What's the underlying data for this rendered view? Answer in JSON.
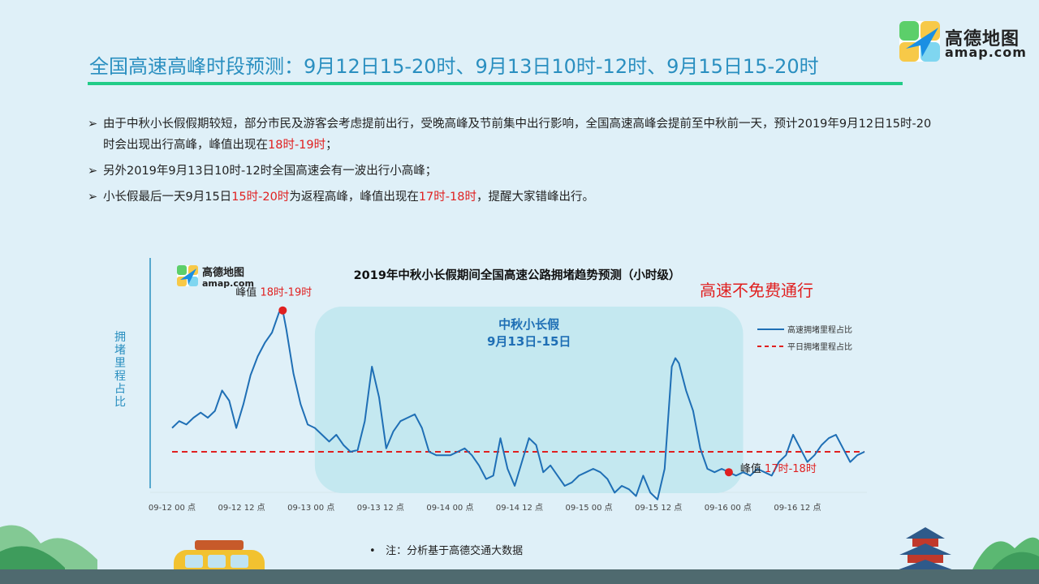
{
  "header": {
    "title": "全国高速高峰时段预测：9月12日15-20时、9月13日10时-12时、9月15日15-20时"
  },
  "logo": {
    "cn": "高德地图",
    "en": "amap.com"
  },
  "bullets": [
    {
      "parts": [
        {
          "text": "由于中秋小长假假期较短，部分市民及游客会考虑提前出行，受晚高峰及节前集中出行影响，全国高速高峰会提前至中秋前一天，预计2019年9月12日15时-20时会出现出行高峰，峰值出现在",
          "red": false
        },
        {
          "text": "18时-19时",
          "red": true
        },
        {
          "text": "；",
          "red": false
        }
      ]
    },
    {
      "parts": [
        {
          "text": "另外2019年9月13日10时-12时全国高速会有一波出行小高峰；",
          "red": false
        }
      ]
    },
    {
      "parts": [
        {
          "text": "小长假最后一天9月15日",
          "red": false
        },
        {
          "text": "15时-20时",
          "red": true
        },
        {
          "text": "为返程高峰，峰值出现在",
          "red": false
        },
        {
          "text": "17时-18时",
          "red": true
        },
        {
          "text": "，提醒大家错峰出行。",
          "red": false
        }
      ]
    }
  ],
  "chart_data": {
    "type": "line",
    "title": "2019年中秋小长假期间全国高速公路拥堵趋势预测（小时级）",
    "ylabel": "拥堵里程占比",
    "note_top_right": "高速不免费通行",
    "holiday": {
      "title": "中秋小长假",
      "dates": "9月13日-15日",
      "from_x": 20,
      "to_x": 80
    },
    "x_ticks": [
      "09-12 00 点",
      "09-12 12 点",
      "09-13 00 点",
      "09-13 12 点",
      "09-14 00 点",
      "09-14 12 点",
      "09-15 00 点",
      "09-15 12 点",
      "09-16 00 点",
      "09-16 12 点"
    ],
    "legend": [
      "高速拥堵里程占比",
      "平日拥堵里程占比"
    ],
    "baseline": 0,
    "annotations": [
      {
        "label": "峰值",
        "range": "18时-19时",
        "x": 15.5
      },
      {
        "label": "峰值",
        "range": "17时-18时",
        "x": 78
      }
    ],
    "series": [
      {
        "name": "高速拥堵里程占比",
        "points": [
          [
            0,
            14
          ],
          [
            1,
            18
          ],
          [
            2,
            16
          ],
          [
            3,
            20
          ],
          [
            4,
            23
          ],
          [
            5,
            20
          ],
          [
            6,
            24
          ],
          [
            7,
            36
          ],
          [
            8,
            30
          ],
          [
            9,
            14
          ],
          [
            10,
            28
          ],
          [
            11,
            45
          ],
          [
            12,
            56
          ],
          [
            13,
            64
          ],
          [
            14,
            70
          ],
          [
            15,
            82
          ],
          [
            15.5,
            83
          ],
          [
            16,
            72
          ],
          [
            17,
            46
          ],
          [
            18,
            28
          ],
          [
            19,
            16
          ],
          [
            20,
            14
          ],
          [
            21,
            10
          ],
          [
            22,
            6
          ],
          [
            23,
            10
          ],
          [
            24,
            4
          ],
          [
            25,
            0
          ],
          [
            26,
            1
          ],
          [
            27,
            18
          ],
          [
            28,
            50
          ],
          [
            29,
            32
          ],
          [
            30,
            2
          ],
          [
            31,
            12
          ],
          [
            32,
            18
          ],
          [
            33,
            20
          ],
          [
            34,
            22
          ],
          [
            35,
            14
          ],
          [
            36,
            0
          ],
          [
            37,
            -2
          ],
          [
            38,
            -2
          ],
          [
            39,
            -2
          ],
          [
            40,
            0
          ],
          [
            41,
            2
          ],
          [
            42,
            -2
          ],
          [
            43,
            -8
          ],
          [
            44,
            -16
          ],
          [
            45,
            -14
          ],
          [
            46,
            8
          ],
          [
            47,
            -10
          ],
          [
            48,
            -20
          ],
          [
            49,
            -6
          ],
          [
            50,
            8
          ],
          [
            51,
            4
          ],
          [
            52,
            -12
          ],
          [
            53,
            -8
          ],
          [
            54,
            -14
          ],
          [
            55,
            -20
          ],
          [
            56,
            -18
          ],
          [
            57,
            -14
          ],
          [
            58,
            -12
          ],
          [
            59,
            -10
          ],
          [
            60,
            -12
          ],
          [
            61,
            -16
          ],
          [
            62,
            -24
          ],
          [
            63,
            -20
          ],
          [
            64,
            -22
          ],
          [
            65,
            -26
          ],
          [
            66,
            -14
          ],
          [
            67,
            -24
          ],
          [
            68,
            -28
          ],
          [
            69,
            -10
          ],
          [
            70,
            50
          ],
          [
            70.5,
            55
          ],
          [
            71,
            52
          ],
          [
            72,
            36
          ],
          [
            73,
            24
          ],
          [
            74,
            2
          ],
          [
            75,
            -10
          ],
          [
            76,
            -12
          ],
          [
            77,
            -10
          ],
          [
            78,
            -12
          ],
          [
            79,
            -14
          ],
          [
            80,
            -12
          ],
          [
            81,
            -14
          ],
          [
            82,
            -10
          ],
          [
            83,
            -12
          ],
          [
            84,
            -14
          ],
          [
            85,
            -6
          ],
          [
            86,
            -2
          ],
          [
            87,
            10
          ],
          [
            88,
            2
          ],
          [
            89,
            -6
          ],
          [
            90,
            -2
          ],
          [
            91,
            4
          ],
          [
            92,
            8
          ],
          [
            93,
            10
          ],
          [
            94,
            2
          ],
          [
            95,
            -6
          ],
          [
            96,
            -2
          ],
          [
            97,
            0
          ]
        ]
      }
    ],
    "colors": {
      "line": "#1f6fb5",
      "baseline": "#e02020",
      "peak": "#e02020",
      "holiday_fill": "#bfe6ef",
      "holiday_text": "#1f6fb5"
    }
  },
  "footnote": "注：分析基于高德交通大数据"
}
